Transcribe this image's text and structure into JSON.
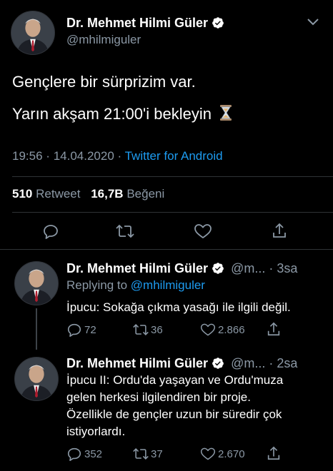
{
  "main_tweet": {
    "display_name": "Dr. Mehmet Hilmi Güler",
    "handle": "@mhilmiguler",
    "text_line1": "Gençlere bir sürprizim var.",
    "text_line2": "Yarın akşam 21:00'i bekleyin",
    "emoji": "⌛",
    "time": "19:56",
    "sep1": "·",
    "date": "14.04.2020",
    "sep2": "·",
    "source": "Twitter for Android",
    "retweet_count": "510",
    "retweet_label": "Retweet",
    "like_count": "16,7B",
    "like_label": "Beğeni"
  },
  "reply1": {
    "display_name": "Dr. Mehmet Hilmi Güler",
    "handle_truncated": "@m...",
    "time_ago": "· 3sa",
    "replying_label": "Replying to",
    "replying_handle": "@mhilmiguler",
    "text": "İpucu: Sokağa çıkma yasağı ile ilgili değil.",
    "reply_count": "72",
    "retweet_count": "36",
    "like_count": "2.866"
  },
  "reply2": {
    "display_name": "Dr. Mehmet Hilmi Güler",
    "handle_truncated": "@m...",
    "time_ago": "· 2sa",
    "text_line1": "İpucu II: Ordu'da yaşayan ve Ordu'muza",
    "text_line2": "gelen herkesi ilgilendiren bir proje.",
    "text_line3": "Özellikle de gençler uzun bir süredir çok",
    "text_line4": "istiyorlardı.",
    "reply_count": "352",
    "retweet_count": "37",
    "like_count": "2.670"
  },
  "colors": {
    "background": "#000000",
    "accent": "#1d9bf0",
    "muted": "#8b98a5",
    "divider": "#2f3336"
  },
  "icons": [
    "chevron-down-icon",
    "verified-badge-icon",
    "reply-icon",
    "retweet-icon",
    "like-icon",
    "share-icon",
    "hourglass-icon"
  ]
}
